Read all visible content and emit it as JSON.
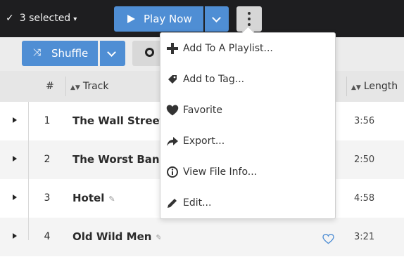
{
  "topbar": {
    "check": "✓",
    "selected_label": "3 selected",
    "selected_caret": "▾",
    "play_label": "Play Now"
  },
  "toolbar": {
    "shuffle_icon": "⤨",
    "shuffle_label": "Shuffle"
  },
  "table": {
    "headers": {
      "number": "#",
      "track": "Track",
      "length": "Length"
    },
    "rows": [
      {
        "num": "1",
        "track": "The Wall Street Sh",
        "length": "3:56"
      },
      {
        "num": "2",
        "track": "The Worst Band In",
        "length": "2:50"
      },
      {
        "num": "3",
        "track": "Hotel",
        "length": "4:58"
      },
      {
        "num": "4",
        "track": "Old Wild Men",
        "length": "3:21"
      }
    ]
  },
  "menu": {
    "items": [
      {
        "label": "Add To A Playlist...",
        "icon": "plus-icon"
      },
      {
        "label": "Add to Tag...",
        "icon": "tag-icon"
      },
      {
        "label": "Favorite",
        "icon": "heart-icon"
      },
      {
        "label": "Export...",
        "icon": "share-arrow-icon"
      },
      {
        "label": "View File Info...",
        "icon": "info-icon"
      },
      {
        "label": "Edit...",
        "icon": "pencil-icon"
      }
    ]
  },
  "colors": {
    "accent": "#4f8ed4",
    "topbar": "#1e1e20",
    "toolbar": "#ececec"
  }
}
